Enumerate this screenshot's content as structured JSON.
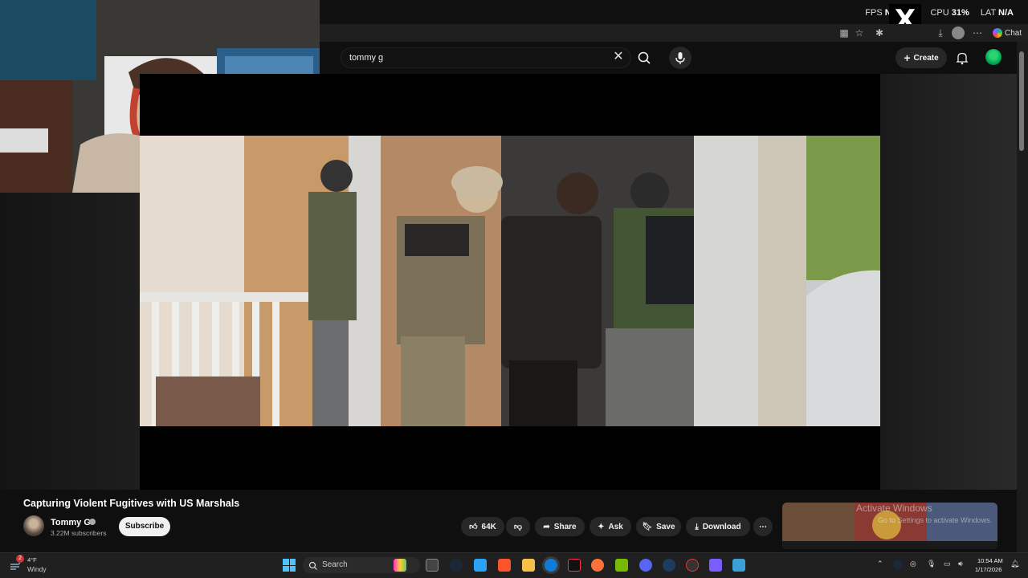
{
  "overlay": {
    "fps_label": "FPS",
    "fps_value": "N/A",
    "cpu_value_partial": "%",
    "cpu_label": "CPU",
    "cpu_value": "31%",
    "lat_label": "LAT",
    "lat_value": "N/A",
    "x_logo": "X"
  },
  "browser": {
    "chat_label": "Chat"
  },
  "youtube": {
    "search_value": "tommy g",
    "create_label": "Create",
    "video": {
      "title": "Capturing Violent Fugitives with US Marshals"
    },
    "channel": {
      "name": "Tommy G",
      "subscribers": "3.22M subscribers",
      "subscribe_label": "Subscribe"
    },
    "actions": {
      "likes": "64K",
      "share_label": "Share",
      "ask_label": "Ask",
      "save_label": "Save",
      "download_label": "Download"
    },
    "windows_watermark_1": "Activate Windows",
    "windows_watermark_2": "Go to Settings to activate Windows."
  },
  "taskbar": {
    "weather_temp": "4°F",
    "weather_desc": "Windy",
    "weather_badge": "2",
    "search_placeholder": "Search",
    "time": "10:54 AM",
    "date": "1/17/2026"
  },
  "colors": {
    "accent": "#3ea6ff",
    "youtube_bg": "#0f0f0f",
    "pill": "#272727",
    "subscribe_bg": "#f1f1f1"
  }
}
